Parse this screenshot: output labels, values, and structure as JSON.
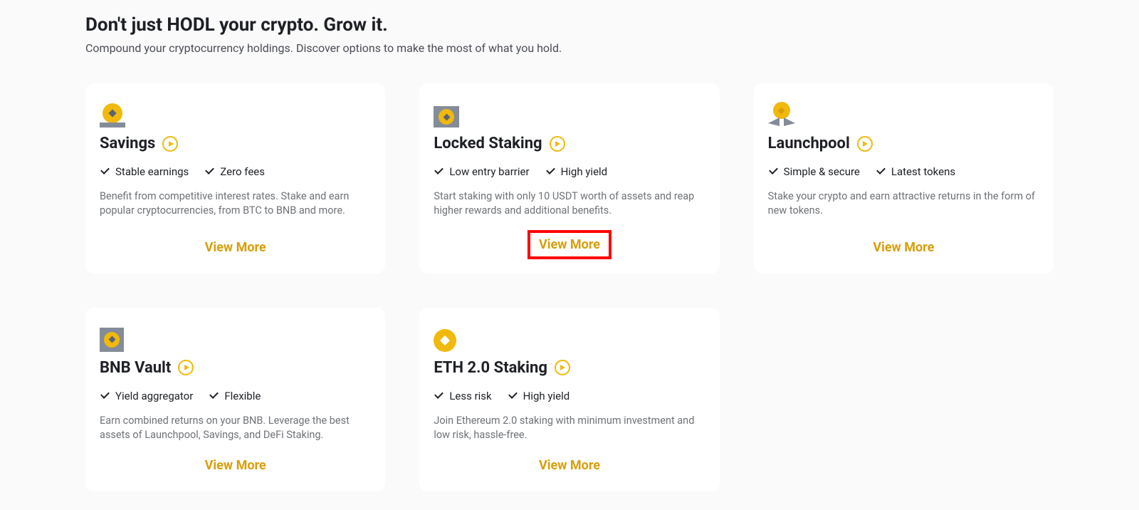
{
  "header": {
    "title": "Don't just HODL your crypto. Grow it.",
    "subtitle": "Compound your cryptocurrency holdings. Discover options to make the most of what you hold."
  },
  "view_more_label": "View More",
  "cards": [
    {
      "id": "savings",
      "icon": "savings-icon",
      "title": "Savings",
      "features": [
        "Stable earnings",
        "Zero fees"
      ],
      "desc": "Benefit from competitive interest rates. Stake and earn popular cryptocurrencies, from BTC to BNB and more.",
      "highlighted": false
    },
    {
      "id": "locked-staking",
      "icon": "locked-staking-icon",
      "title": "Locked Staking",
      "features": [
        "Low entry barrier",
        "High yield"
      ],
      "desc": "Start staking with only 10 USDT worth of assets and reap higher rewards and additional benefits.",
      "highlighted": true
    },
    {
      "id": "launchpool",
      "icon": "launchpool-icon",
      "title": "Launchpool",
      "features": [
        "Simple & secure",
        "Latest tokens"
      ],
      "desc": "Stake your crypto and earn attractive returns in the form of new tokens.",
      "highlighted": false
    },
    {
      "id": "bnb-vault",
      "icon": "bnb-vault-icon",
      "title": "BNB Vault",
      "features": [
        "Yield aggregator",
        "Flexible"
      ],
      "desc": "Earn combined returns on your BNB. Leverage the best assets of Launchpool, Savings, and DeFi Staking.",
      "highlighted": false
    },
    {
      "id": "eth2-staking",
      "icon": "eth2-staking-icon",
      "title": "ETH 2.0 Staking",
      "features": [
        "Less risk",
        "High yield"
      ],
      "desc": "Join Ethereum 2.0 staking with minimum investment and low risk, hassle-free.",
      "highlighted": false
    }
  ]
}
